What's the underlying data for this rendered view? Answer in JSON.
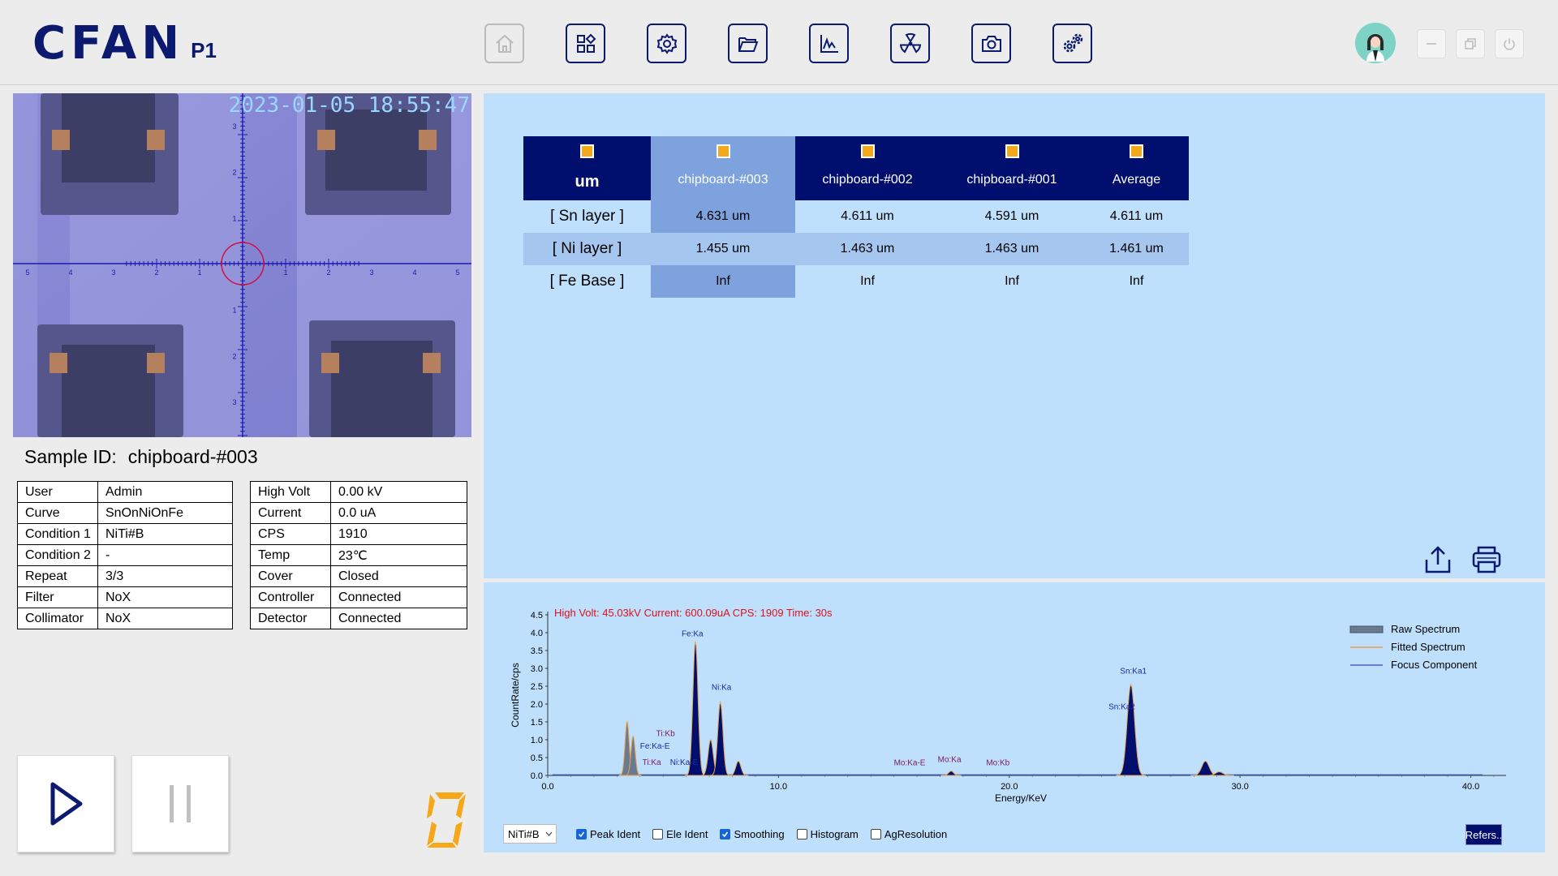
{
  "header": {
    "brand": "CFAN",
    "model": "P1",
    "toolbar": [
      {
        "name": "home-button",
        "icon": "home-icon",
        "disabled": true
      },
      {
        "name": "apps-button",
        "icon": "grid-icon",
        "disabled": false
      },
      {
        "name": "settings-button",
        "icon": "gear-icon",
        "disabled": false
      },
      {
        "name": "open-folder-button",
        "icon": "folder-icon",
        "disabled": false
      },
      {
        "name": "spectrum-button",
        "icon": "chart-line-icon",
        "disabled": false
      },
      {
        "name": "radiation-button",
        "icon": "radiation-icon",
        "disabled": false
      },
      {
        "name": "camera-button",
        "icon": "camera-icon",
        "disabled": false
      },
      {
        "name": "advanced-settings-button",
        "icon": "gears-icon",
        "disabled": false
      }
    ],
    "window_controls": [
      "minimize-icon",
      "restore-icon",
      "power-icon"
    ]
  },
  "camera": {
    "timestamp": "2023-01-05 18:55:47",
    "x_ticks": [
      "5",
      "4",
      "3",
      "2",
      "1",
      "1",
      "2",
      "3",
      "4",
      "5"
    ],
    "y_ticks": [
      "3",
      "2",
      "1",
      "1",
      "2",
      "3"
    ]
  },
  "sample": {
    "label": "Sample ID:",
    "value": "chipboard-#003"
  },
  "info_left": [
    [
      "User",
      "Admin"
    ],
    [
      "Curve",
      "SnOnNiOnFe"
    ],
    [
      "Condition 1",
      "NiTi#B"
    ],
    [
      "Condition 2",
      "-"
    ],
    [
      "Repeat",
      "3/3"
    ],
    [
      "Filter",
      "NoX"
    ],
    [
      "Collimator",
      "NoX"
    ]
  ],
  "info_right": [
    [
      "High Volt",
      "0.00 kV"
    ],
    [
      "Current",
      "0.0 uA"
    ],
    [
      "CPS",
      "1910"
    ],
    [
      "Temp",
      "23℃"
    ],
    [
      "Cover",
      "Closed"
    ],
    [
      "Controller",
      "Connected"
    ],
    [
      "Detector",
      "Connected"
    ]
  ],
  "counter_digit": "0",
  "results": {
    "unit": "um",
    "columns": [
      "chipboard-#003",
      "chipboard-#002",
      "chipboard-#001",
      "Average"
    ],
    "rows": [
      {
        "label": "[ Sn layer ]",
        "values": [
          "4.631 um",
          "4.611 um",
          "4.591 um",
          "4.611 um"
        ]
      },
      {
        "label": "[ Ni layer ]",
        "values": [
          "1.455 um",
          "1.463 um",
          "1.463 um",
          "1.461 um"
        ]
      },
      {
        "label": "[ Fe Base ]",
        "values": [
          "Inf",
          "Inf",
          "Inf",
          "Inf"
        ]
      }
    ]
  },
  "chart_data": {
    "type": "line",
    "xlabel": "Energy/KeV",
    "ylabel": "CountRate/cps",
    "xlim": [
      0,
      41
    ],
    "ylim": [
      0,
      4.5
    ],
    "x_ticks": [
      "0.0",
      "10.0",
      "20.0",
      "30.0",
      "40.0"
    ],
    "y_ticks": [
      "0.0",
      "0.5",
      "1.0",
      "1.5",
      "2.0",
      "2.5",
      "3.0",
      "3.5",
      "4.0",
      "4.5"
    ],
    "info_text": "High Volt: 45.03kV  Current: 600.09uA  CPS: 1909  Time: 30s",
    "legend": [
      "Raw Spectrum",
      "Fitted Spectrum",
      "Focus Component"
    ],
    "legend_position": "top-right",
    "peaks": [
      {
        "x": 3.44,
        "y": 1.5
      },
      {
        "x": 3.7,
        "y": 1.1
      },
      {
        "x": 6.4,
        "y": 3.75
      },
      {
        "x": 7.06,
        "y": 1.0
      },
      {
        "x": 7.48,
        "y": 2.05
      },
      {
        "x": 8.26,
        "y": 0.4
      },
      {
        "x": 17.48,
        "y": 0.12
      },
      {
        "x": 25.27,
        "y": 2.55
      },
      {
        "x": 28.5,
        "y": 0.4
      },
      {
        "x": 29.1,
        "y": 0.1
      }
    ],
    "annotations": [
      {
        "text": "Ti:Kb",
        "x": 4.7,
        "y": 1.1,
        "color": "#7a1a5a"
      },
      {
        "text": "Fe:Ka-E",
        "x": 4.0,
        "y": 0.75,
        "color": "#1a2aa0"
      },
      {
        "text": "Ti:Ka",
        "x": 4.1,
        "y": 0.3,
        "color": "#7a1a5a"
      },
      {
        "text": "Ni:Ka-E",
        "x": 5.3,
        "y": 0.3,
        "color": "#1a2aa0"
      },
      {
        "text": "Fe:Ka",
        "x": 5.8,
        "y": 3.9,
        "color": "#1a2aa0"
      },
      {
        "text": "Ni:Ka",
        "x": 7.1,
        "y": 2.4,
        "color": "#1a2aa0"
      },
      {
        "text": "Mo:Ka-E",
        "x": 15.0,
        "y": 0.28,
        "color": "#7a1a5a"
      },
      {
        "text": "Mo:Ka",
        "x": 16.9,
        "y": 0.38,
        "color": "#7a1a5a"
      },
      {
        "text": "Mo:Kb",
        "x": 19.0,
        "y": 0.28,
        "color": "#7a1a5a"
      },
      {
        "text": "Sn:Ka1",
        "x": 24.8,
        "y": 2.85,
        "color": "#1a2aa0"
      },
      {
        "text": "Sn:Ka2",
        "x": 24.3,
        "y": 1.85,
        "color": "#1a2aa0"
      }
    ]
  },
  "controls": {
    "curve_select": "NiTi#B",
    "checkboxes": [
      {
        "label": "Peak Ident",
        "checked": true
      },
      {
        "label": "Ele Ident",
        "checked": false
      },
      {
        "label": "Smoothing",
        "checked": true
      },
      {
        "label": "Histogram",
        "checked": false
      },
      {
        "label": "AgResolution",
        "checked": false
      }
    ],
    "refer_label": "Refers.."
  }
}
